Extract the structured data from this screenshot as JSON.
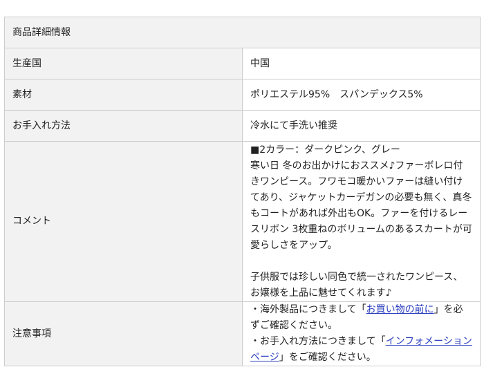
{
  "table": {
    "header": "商品詳細情報",
    "rows": {
      "origin": {
        "label": "生産国",
        "value": "中国"
      },
      "material": {
        "label": "素材",
        "value": "ポリエステル95%　スパンデックス5%"
      },
      "care": {
        "label": "お手入れ方法",
        "value": "冷水にて手洗い推奨"
      },
      "comment": {
        "label": "コメント",
        "line1": "■2カラー：ダークピンク、グレー",
        "para1": "寒い日 冬のお出かけにおススメ♪ファーボレロ付きワンピース。フワモコ暖かいファーは縫い付けてあり、ジャケットカーデガンの必要も無く、真冬もコートがあれば外出もOK。ファーを付けるレースリボン 3枚重ねのボリュームのあるスカートが可愛らしさをアップ。",
        "para2": "子供服では珍しい同色で統一されたワンピース、お嬢様を上品に魅せてくれます♪"
      },
      "notes": {
        "label": "注意事項",
        "note1_prefix": "・海外製品につきまして「",
        "note1_link": "お買い物の前に",
        "note1_suffix": "」を必ずご確認ください。",
        "note2_prefix": "・お手入れ方法につきまして「",
        "note2_link": "インフォメーションページ",
        "note2_suffix": "」をご確認ください。"
      }
    }
  },
  "colors": {
    "label_bg": "#f2f2f2",
    "border": "#cccccc",
    "link": "#2b3fbf"
  }
}
